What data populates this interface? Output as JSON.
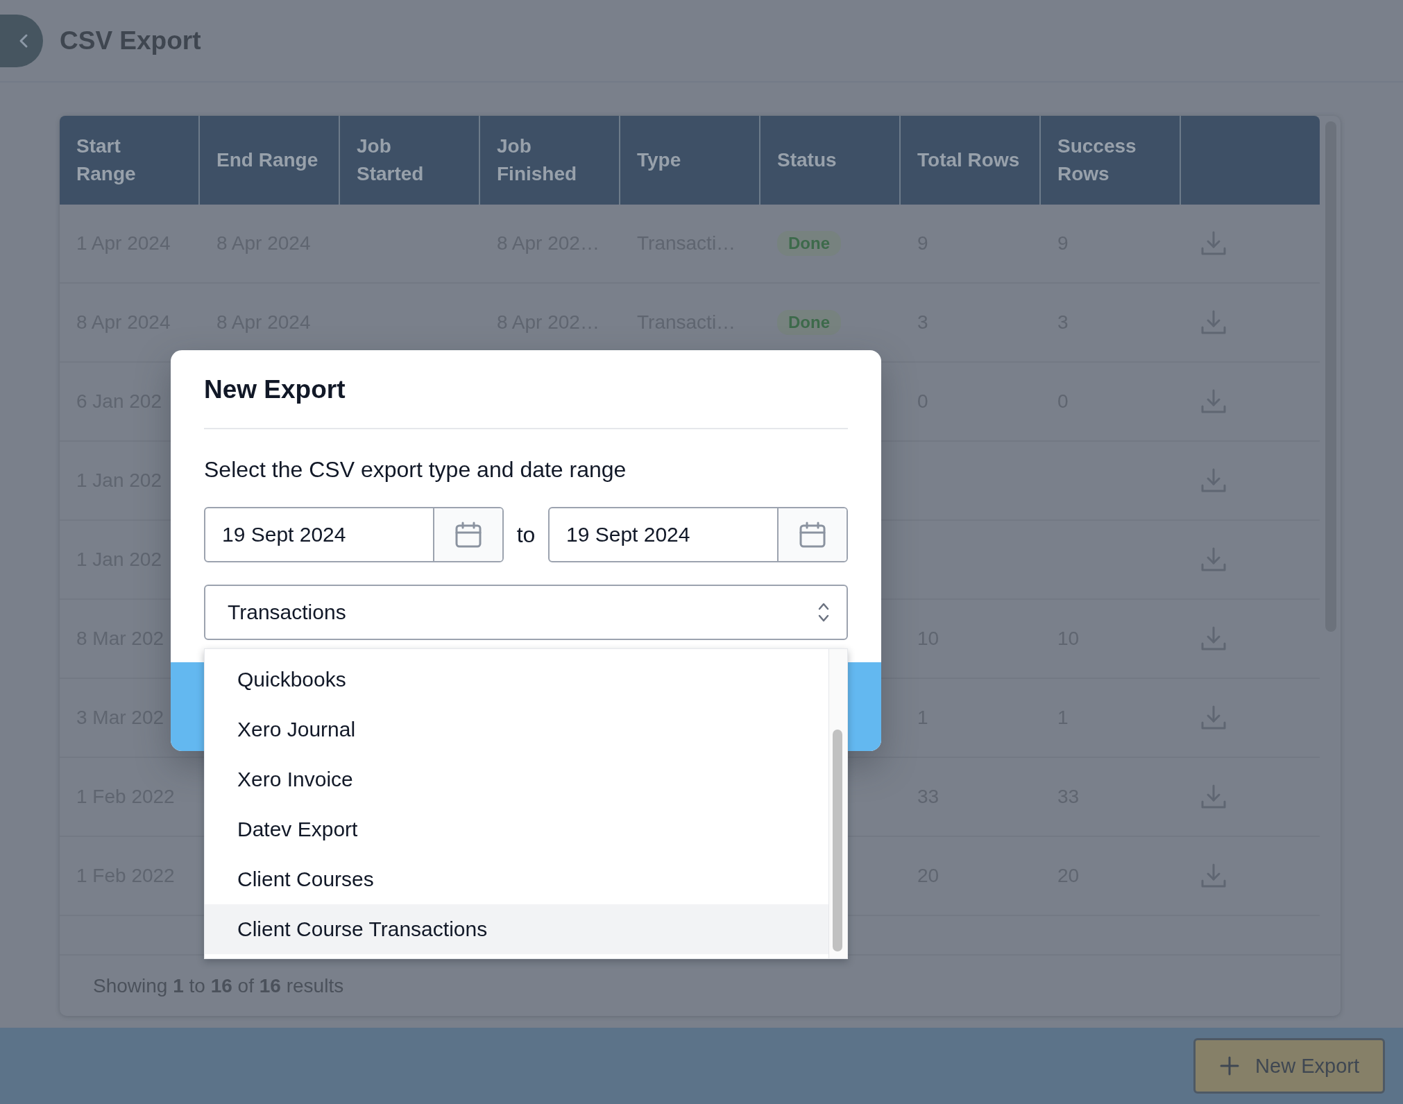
{
  "header": {
    "title": "CSV Export"
  },
  "table": {
    "columns": [
      "Start Range",
      "End Range",
      "Job Started",
      "Job Finished",
      "Type",
      "Status",
      "Total Rows",
      "Success Rows"
    ],
    "rows": [
      {
        "start_range": "1 Apr 2024",
        "end_range": "8 Apr 2024",
        "job_finished": "8 Apr 202…",
        "type": "Transacti…",
        "status": "Done",
        "total_rows": "9",
        "success_rows": "9"
      },
      {
        "start_range": "8 Apr 2024",
        "end_range": "8 Apr 2024",
        "job_finished": "8 Apr 202…",
        "type": "Transacti…",
        "status": "Done",
        "total_rows": "3",
        "success_rows": "3"
      },
      {
        "start_range": "6 Jan 202",
        "total_rows": "0",
        "success_rows": "0"
      },
      {
        "start_range": "1 Jan 202"
      },
      {
        "start_range": "1 Jan 202"
      },
      {
        "start_range": "8 Mar 202",
        "total_rows": "10",
        "success_rows": "10"
      },
      {
        "start_range": "3 Mar 202",
        "total_rows": "1",
        "success_rows": "1"
      },
      {
        "start_range": "1 Feb 2022",
        "total_rows": "33",
        "success_rows": "33"
      },
      {
        "start_range": "1 Feb 2022",
        "total_rows": "20",
        "success_rows": "20"
      }
    ],
    "footer": "Showing **1** to **16** of **16** results"
  },
  "new_export_button": "New Export",
  "modal": {
    "title": "New Export",
    "instruction": "Select the CSV export type and date range",
    "start_date": "19 Sept 2024",
    "separator": "to",
    "end_date": "19 Sept 2024",
    "type_select": {
      "value": "Transactions"
    },
    "options": [
      {
        "label": "Quickbooks",
        "highlighted": false
      },
      {
        "label": "Xero Journal",
        "highlighted": false
      },
      {
        "label": "Xero Invoice",
        "highlighted": false
      },
      {
        "label": "Datev Export",
        "highlighted": false
      },
      {
        "label": "Client Courses",
        "highlighted": false
      },
      {
        "label": "Client Course Transactions",
        "highlighted": true
      }
    ]
  }
}
